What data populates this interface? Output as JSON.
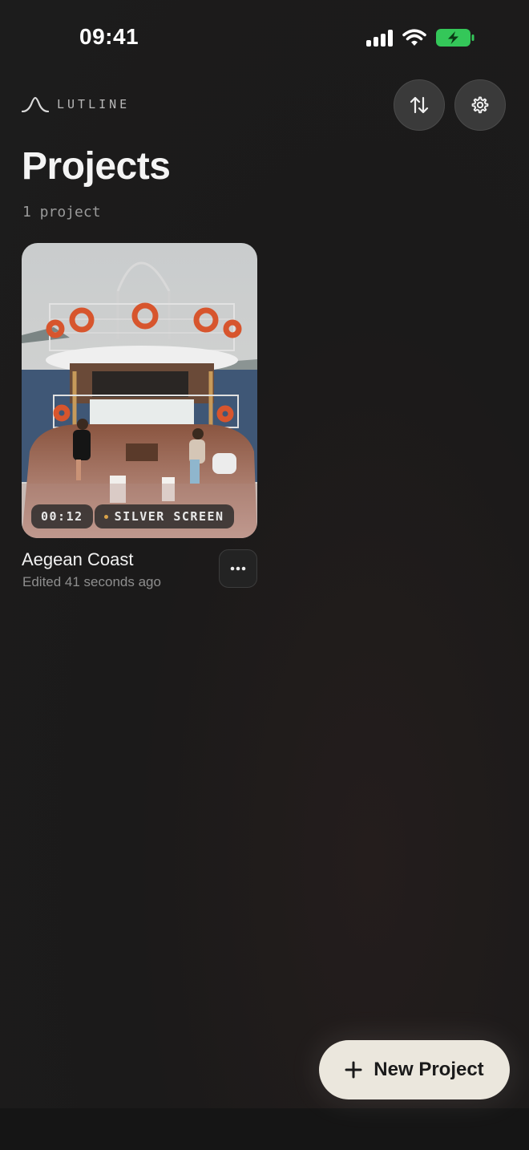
{
  "status_bar": {
    "time": "09:41"
  },
  "header": {
    "app_name": "LUTLINE"
  },
  "page": {
    "title": "Projects",
    "count_label": "1 project"
  },
  "projects": [
    {
      "title": "Aegean Coast",
      "edited": "Edited 41 seconds ago",
      "duration": "00:12",
      "look": "SILVER SCREEN"
    }
  ],
  "actions": {
    "new_project_label": "New Project"
  },
  "icons": {
    "logo": "lutline-curve-icon",
    "sort": "sort-arrows-icon",
    "settings": "gear-icon",
    "more": "ellipsis-icon",
    "add": "plus-icon"
  },
  "colors": {
    "accent_dot": "#d9a24a",
    "battery": "#34c759",
    "primary_button": "#ebe7dd"
  }
}
